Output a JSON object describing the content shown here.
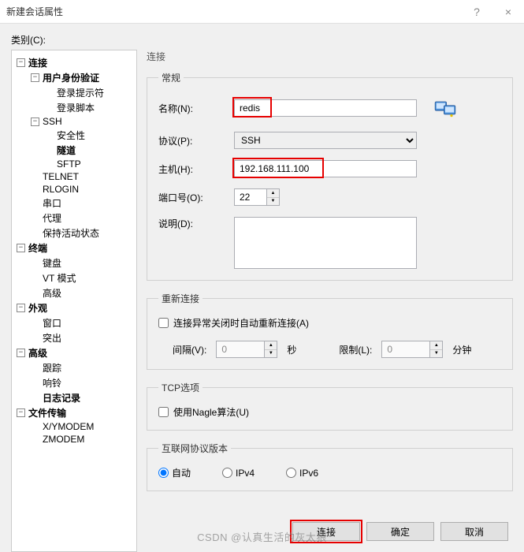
{
  "window": {
    "title": "新建会话属性",
    "help_label": "?",
    "close_label": "×"
  },
  "category_label": "类别(C):",
  "tree": [
    {
      "label": "连接",
      "level": 0,
      "bold": true,
      "expand": "−"
    },
    {
      "label": "用户身份验证",
      "level": 1,
      "bold": true,
      "expand": "−"
    },
    {
      "label": "登录提示符",
      "level": 2,
      "bold": false
    },
    {
      "label": "登录脚本",
      "level": 2,
      "bold": false
    },
    {
      "label": "SSH",
      "level": 1,
      "bold": false,
      "expand": "−"
    },
    {
      "label": "安全性",
      "level": 2,
      "bold": false
    },
    {
      "label": "隧道",
      "level": 2,
      "bold": true
    },
    {
      "label": "SFTP",
      "level": 2,
      "bold": false
    },
    {
      "label": "TELNET",
      "level": 1,
      "bold": false
    },
    {
      "label": "RLOGIN",
      "level": 1,
      "bold": false
    },
    {
      "label": "串口",
      "level": 1,
      "bold": false
    },
    {
      "label": "代理",
      "level": 1,
      "bold": false
    },
    {
      "label": "保持活动状态",
      "level": 1,
      "bold": false
    },
    {
      "label": "终端",
      "level": 0,
      "bold": true,
      "expand": "−"
    },
    {
      "label": "键盘",
      "level": 1,
      "bold": false
    },
    {
      "label": "VT 模式",
      "level": 1,
      "bold": false
    },
    {
      "label": "高级",
      "level": 1,
      "bold": false
    },
    {
      "label": "外观",
      "level": 0,
      "bold": true,
      "expand": "−"
    },
    {
      "label": "窗口",
      "level": 1,
      "bold": false
    },
    {
      "label": "突出",
      "level": 1,
      "bold": false
    },
    {
      "label": "高级",
      "level": 0,
      "bold": true,
      "expand": "−"
    },
    {
      "label": "跟踪",
      "level": 1,
      "bold": false
    },
    {
      "label": "响铃",
      "level": 1,
      "bold": false
    },
    {
      "label": "日志记录",
      "level": 1,
      "bold": true
    },
    {
      "label": "文件传输",
      "level": 0,
      "bold": true,
      "expand": "−"
    },
    {
      "label": "X/YMODEM",
      "level": 1,
      "bold": false
    },
    {
      "label": "ZMODEM",
      "level": 1,
      "bold": false
    }
  ],
  "right": {
    "heading": "连接",
    "general": {
      "legend": "常规",
      "name_label": "名称(N):",
      "name_value": "redis",
      "protocol_label": "协议(P):",
      "protocol_value": "SSH",
      "host_label": "主机(H):",
      "host_value": "192.168.111.100",
      "port_label": "端口号(O):",
      "port_value": "22",
      "desc_label": "说明(D):",
      "desc_value": ""
    },
    "reconnect": {
      "legend": "重新连接",
      "checkbox_label": "连接异常关闭时自动重新连接(A)",
      "interval_label": "间隔(V):",
      "interval_value": "0",
      "interval_unit": "秒",
      "limit_label": "限制(L):",
      "limit_value": "0",
      "limit_unit": "分钟"
    },
    "tcp": {
      "legend": "TCP选项",
      "nagle_label": "使用Nagle算法(U)"
    },
    "ip": {
      "legend": "互联网协议版本",
      "auto": "自动",
      "ipv4": "IPv4",
      "ipv6": "IPv6",
      "selected": "auto"
    }
  },
  "buttons": {
    "connect": "连接",
    "ok": "确定",
    "cancel": "取消"
  },
  "watermark": "CSDN @认真生活的灰太狼"
}
